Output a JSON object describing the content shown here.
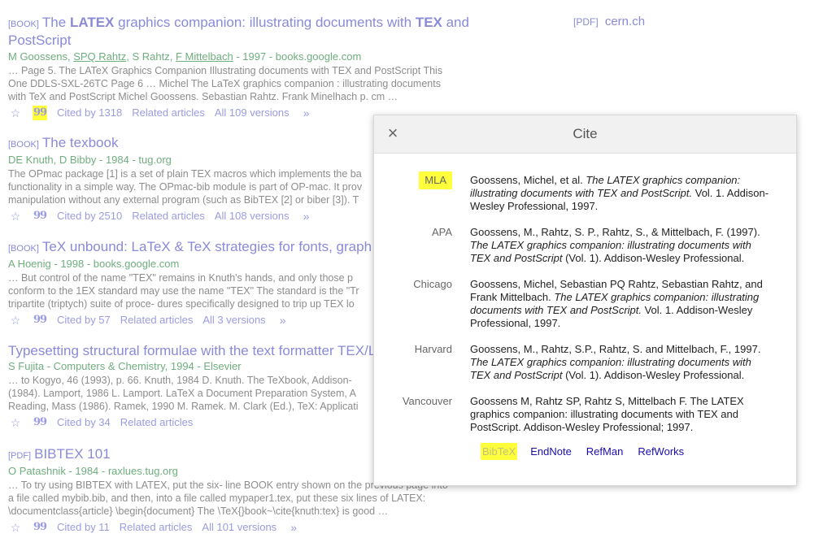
{
  "results": [
    {
      "tag": "[BOOK]",
      "title_parts": [
        "The ",
        "LATEX",
        " graphics companion: illustrating documents with ",
        "TEX",
        " and"
      ],
      "title_line2": "PostScript",
      "authors": [
        "M Goossens, ",
        "SPQ Rahtz",
        ", S Rahtz, ",
        "F Mittelbach",
        " - 1997 - books.google.com"
      ],
      "snippet": [
        "… Page 5. The LATeX Graphics Companion Illustrating documents with TEX and PostScript This",
        "One DDLS-SXL-26TC Page 6 … Michel The LaTeX graphics companion : illustrating documents",
        "with TeX and PostScript Michel Goossens. Sebastian Rahtz. Frank Minelhach p. cm …"
      ],
      "actions": [
        "Cited by 1318",
        "Related articles",
        "All 109 versions"
      ]
    },
    {
      "tag": "[BOOK]",
      "title": "The texbook",
      "authors": "DE Knuth, D Bibby - 1984 - tug.org",
      "snippet": [
        "The OPmac package [1] is a set of plain TEX macros which implements the ba",
        "functionality in a simple way. The OPmac-bib module is part of OP-mac. It prov",
        "manipulation without any external program (such as BibTEX [2] or biber [3]). T"
      ],
      "actions": [
        "Cited by 2510",
        "Related articles",
        "All 108 versions"
      ]
    },
    {
      "tag": "[BOOK]",
      "title": "TeX unbound: LaTeX & TeX strategies for fonts, graph",
      "authors": "A Hoenig - 1998 - books.google.com",
      "snippet": [
        "… But control of the name \"TEX\" remains in Knuth's hands, and only those p",
        "conform to the 1EX standard may use the name \"TEX\" The standard is the \"Tr",
        "tripartite (triptych) suite of proce- dures specifically designed to trip up TEX lo"
      ],
      "actions": [
        "Cited by 57",
        "Related articles",
        "All 3 versions"
      ]
    },
    {
      "tag": "",
      "title": "Typesetting structural formulae with the text formatter TEX/L",
      "authors": "S Fujita - Computers & Chemistry, 1994 - Elsevier",
      "snippet": [
        "… to Kogyo, 46 (1993), p. 66. Knuth, 1984 D. Knuth. The TeXbook, Addison-",
        "(1984). Lamport, 1986 L. Lamport. LaTeX a Document Preparation System, A",
        "Reading, Mass (1986). Ramek, 1990 M. Ramek. M. Clark (Ed.), TeX: Applicati"
      ],
      "actions": [
        "Cited by 34",
        "Related articles"
      ]
    },
    {
      "tag": "[PDF]",
      "title": "BIBTEX 101",
      "authors": "O Patashnik - 1984 - raxlues.tug.org",
      "snippet": [
        "… To try using BIBTEX with LATEX, put the six- line BOOK entry shown on the previous page into",
        "a file called mybib.bib, and then, into a file called mypaper1.tex, put these six lines of LATEX:",
        "\\documentclass{article} \\begin{document} The \\TeX{}book~\\cite{knuth:tex} is good …"
      ],
      "actions": [
        "Cited by 11",
        "Related articles",
        "All 101 versions"
      ]
    }
  ],
  "side_link": {
    "tag": "[PDF]",
    "text": "cern.ch"
  },
  "dialog": {
    "title": "Cite",
    "citations": [
      {
        "style": "MLA",
        "pre": "Goossens, Michel, et al. ",
        "italic": "The LATEX graphics companion: illustrating documents with TEX and PostScript.",
        "post": " Vol. 1. Addison-Wesley Professional, 1997."
      },
      {
        "style": "APA",
        "pre": "Goossens, M., Rahtz, S. P., Rahtz, S., & Mittelbach, F. (1997). ",
        "italic": "The LATEX graphics companion: illustrating documents with TEX and PostScript",
        "post": " (Vol. 1). Addison-Wesley Professional."
      },
      {
        "style": "Chicago",
        "pre": "Goossens, Michel, Sebastian PQ Rahtz, Sebastian Rahtz, and Frank Mittelbach. ",
        "italic": "The LATEX graphics companion: illustrating documents with TEX and PostScript.",
        "post": " Vol. 1. Addison-Wesley Professional, 1997."
      },
      {
        "style": "Harvard",
        "pre": "Goossens, M., Rahtz, S.P., Rahtz, S. and Mittelbach, F., 1997. ",
        "italic": "The LATEX graphics companion: illustrating documents with TEX and PostScript",
        "post": " (Vol. 1). Addison-Wesley Professional."
      },
      {
        "style": "Vancouver",
        "pre": "Goossens M, Rahtz SP, Rahtz S, Mittelbach F. The LATEX graphics companion: illustrating documents with TEX and PostScript. Addison-Wesley Professional; 1997.",
        "italic": "",
        "post": ""
      }
    ],
    "exports": [
      "BibTeX",
      "EndNote",
      "RefMan",
      "RefWorks"
    ]
  },
  "colors": {
    "link": "#8a8ad8",
    "author": "#6fae7e",
    "highlight": "#ffff3c"
  }
}
